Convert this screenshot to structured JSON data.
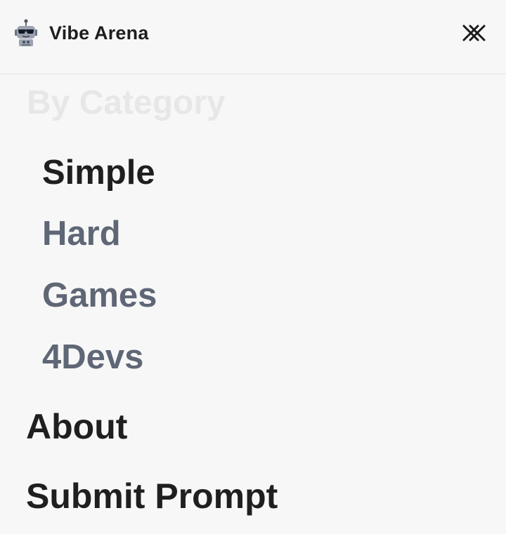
{
  "header": {
    "brand": "Vibe Arena",
    "logo_icon": "robot-sunglasses-icon",
    "close_icon": "close-icon"
  },
  "menu": {
    "section_heading": "By Category",
    "categories": [
      {
        "label": "Simple",
        "active": true
      },
      {
        "label": "Hard",
        "active": false
      },
      {
        "label": "Games",
        "active": false
      },
      {
        "label": "4Devs",
        "active": false
      }
    ],
    "links": [
      {
        "label": "About"
      },
      {
        "label": "Submit Prompt"
      }
    ]
  },
  "colors": {
    "background": "#f7f7f7",
    "text_primary": "#1f1f1f",
    "text_muted": "#5f6675",
    "heading_faint": "#e7e7e7",
    "divider": "#e3e3e3"
  }
}
